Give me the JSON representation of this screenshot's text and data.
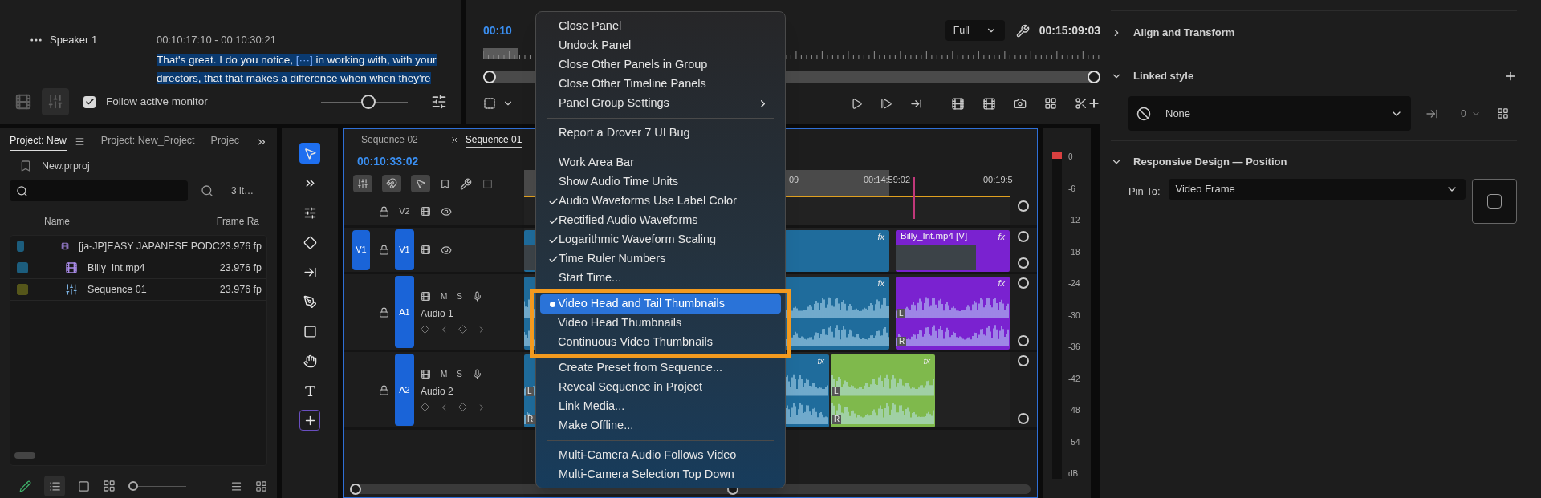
{
  "transcript": {
    "speaker": "Speaker 1",
    "timecode": "00:10:17:10 - 00:10:30:21",
    "text_before": "That's great. I do you notice, ",
    "gap_marker": "[···]",
    "text_after": " in working with, with your directors, that that makes a difference when when they're",
    "highlighted": true,
    "follow": {
      "label": "Follow active monitor",
      "checked": true
    },
    "zoom_slider": {
      "level": 0.55
    }
  },
  "program_monitor": {
    "timecode": "00:10",
    "quality": "Full",
    "duration": "00:15:09:03"
  },
  "context_menu": {
    "items": [
      {
        "kind": "item",
        "label": "Close Panel"
      },
      {
        "kind": "item",
        "label": "Undock Panel"
      },
      {
        "kind": "item",
        "label": "Close Other Panels in Group"
      },
      {
        "kind": "item",
        "label": "Close Other Timeline Panels"
      },
      {
        "kind": "submenu",
        "label": "Panel Group Settings"
      },
      {
        "kind": "separator"
      },
      {
        "kind": "item",
        "label": "Report a Drover 7 UI Bug"
      },
      {
        "kind": "separator"
      },
      {
        "kind": "check",
        "label": "Work Area Bar",
        "checked": false
      },
      {
        "kind": "check",
        "label": "Show Audio Time Units",
        "checked": false
      },
      {
        "kind": "check",
        "label": "Audio Waveforms Use Label Color",
        "checked": true
      },
      {
        "kind": "check",
        "label": "Rectified Audio Waveforms",
        "checked": true
      },
      {
        "kind": "check",
        "label": "Logarithmic Waveform Scaling",
        "checked": true
      },
      {
        "kind": "check",
        "label": "Time Ruler Numbers",
        "checked": true
      },
      {
        "kind": "item",
        "label": "Start Time..."
      },
      {
        "kind": "radio",
        "label": "Video Head and Tail Thumbnails",
        "selected": true
      },
      {
        "kind": "radio",
        "label": "Video Head Thumbnails",
        "selected": false
      },
      {
        "kind": "radio",
        "label": "Continuous Video Thumbnails",
        "selected": false
      },
      {
        "kind": "item",
        "label": "Create Preset from Sequence..."
      },
      {
        "kind": "item",
        "label": "Reveal Sequence in Project"
      },
      {
        "kind": "item",
        "label": "Link Media..."
      },
      {
        "kind": "item",
        "label": "Make Offline..."
      },
      {
        "kind": "separator"
      },
      {
        "kind": "item",
        "label": "Multi-Camera Audio Follows Video"
      },
      {
        "kind": "item",
        "label": "Multi-Camera Selection Top Down"
      }
    ]
  },
  "project_panel": {
    "tabs": [
      {
        "label": "Project: New",
        "selected": true
      },
      {
        "label": "Project: New_Project",
        "selected": false
      },
      {
        "label": "Projec",
        "selected": false
      }
    ],
    "file": "New.prproj",
    "thumbnail_zoom": {
      "level": 0
    },
    "item_count": "3 it…",
    "columns": [
      "Name",
      "Frame Ra"
    ],
    "rows": [
      {
        "color": "#1c5d7d",
        "kind": "clip",
        "name": "[ja-JP]EASY JAPANESE PODC",
        "frame_rate": "23.976 fp"
      },
      {
        "color": "#1c5d7d",
        "kind": "clip",
        "name": "Billy_Int.mp4",
        "frame_rate": "23.976 fp"
      },
      {
        "color": "#55561a",
        "kind": "sequence",
        "name": "Sequence 01",
        "frame_rate": "23.976 fp"
      }
    ]
  },
  "timeline": {
    "tabs": [
      {
        "label": "Sequence 02",
        "selected": false,
        "closable": false
      },
      {
        "label": "Sequence 01",
        "selected": true,
        "closable": true
      }
    ],
    "timecode": "00:10:33:02",
    "ruler_labels": [
      "09",
      "00:14:59:02",
      "00:19:5"
    ],
    "tracks": [
      {
        "kind": "video",
        "name": "V2",
        "targeted": false
      },
      {
        "kind": "video",
        "name": "V1",
        "source": "V1",
        "targeted": true,
        "clips": [
          {
            "color": "#1f6c9c",
            "badge": "fx"
          },
          {
            "color": "#7a22d0",
            "label": "Billy_Int.mp4 [V]",
            "badge": "fx"
          }
        ]
      },
      {
        "kind": "audio",
        "name": "A1",
        "title": "Audio 1",
        "mute": "M",
        "solo": "S",
        "targeted": true,
        "clips": [
          {
            "color": "#1f6c9c",
            "badge": "fx"
          },
          {
            "color": "#7a22d0",
            "badge": "fx",
            "channels": [
              "L",
              "R"
            ]
          }
        ]
      },
      {
        "kind": "audio",
        "name": "A2",
        "title": "Audio 2",
        "mute": "M",
        "solo": "S",
        "targeted": true,
        "clips": [
          {
            "color": "#1f6c9c",
            "badge": "fx",
            "channels": [
              "L",
              "R"
            ]
          },
          {
            "color": "#7fb94c",
            "badge": "fx",
            "channels": [
              "L",
              "R"
            ]
          }
        ]
      }
    ]
  },
  "audio_meter": {
    "scale": [
      "0",
      "-6",
      "-12",
      "-18",
      "-24",
      "-30",
      "-36",
      "-42",
      "-48",
      "-54",
      "dB"
    ]
  },
  "properties": {
    "sections": [
      {
        "title": "Align and Transform",
        "expanded": false
      },
      {
        "title": "Linked style",
        "expanded": true
      },
      {
        "title": "Responsive Design — Position",
        "expanded": true
      }
    ],
    "linked_style": {
      "value": "None",
      "count": "0"
    },
    "pin_to": {
      "label": "Pin To:",
      "value": "Video Frame"
    }
  }
}
